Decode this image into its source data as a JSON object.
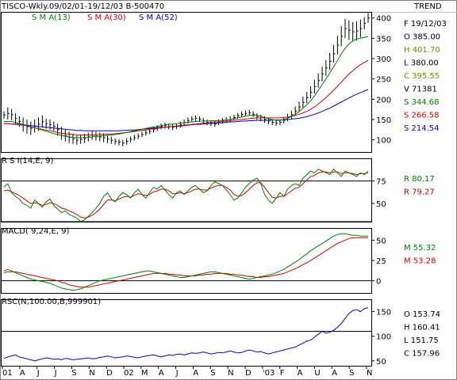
{
  "header": {
    "title": "TISCO-Wkly.09/02/01-19/12/03  B-500470",
    "right": "TREND"
  },
  "chart_data": [
    {
      "type": "line",
      "panel": "price",
      "legend": [
        {
          "name": "S M A(13)",
          "color": "#008000"
        },
        {
          "name": "S M A(30)",
          "color": "#d00000"
        },
        {
          "name": "S M A(52)",
          "color": "#0000c0"
        }
      ],
      "ylim": [
        70,
        415
      ],
      "yticks": [
        "400",
        "350",
        "300",
        "250",
        "200",
        "150",
        "100"
      ],
      "price_hl": [
        [
          170,
          152
        ],
        [
          180,
          150
        ],
        [
          176,
          148
        ],
        [
          165,
          140
        ],
        [
          158,
          132
        ],
        [
          155,
          120
        ],
        [
          150,
          115
        ],
        [
          145,
          112
        ],
        [
          150,
          118
        ],
        [
          155,
          122
        ],
        [
          160,
          130
        ],
        [
          152,
          128
        ],
        [
          150,
          125
        ],
        [
          145,
          122
        ],
        [
          140,
          110
        ],
        [
          132,
          100
        ],
        [
          125,
          96
        ],
        [
          120,
          92
        ],
        [
          115,
          90
        ],
        [
          110,
          88
        ],
        [
          112,
          90
        ],
        [
          115,
          92
        ],
        [
          118,
          96
        ],
        [
          122,
          100
        ],
        [
          120,
          98
        ],
        [
          118,
          96
        ],
        [
          116,
          94
        ],
        [
          112,
          92
        ],
        [
          108,
          90
        ],
        [
          104,
          88
        ],
        [
          102,
          86
        ],
        [
          100,
          84
        ],
        [
          104,
          88
        ],
        [
          108,
          94
        ],
        [
          112,
          98
        ],
        [
          116,
          102
        ],
        [
          120,
          106
        ],
        [
          124,
          110
        ],
        [
          128,
          114
        ],
        [
          132,
          118
        ],
        [
          136,
          122
        ],
        [
          140,
          126
        ],
        [
          142,
          128
        ],
        [
          140,
          126
        ],
        [
          138,
          124
        ],
        [
          140,
          126
        ],
        [
          145,
          130
        ],
        [
          150,
          135
        ],
        [
          155,
          140
        ],
        [
          158,
          144
        ],
        [
          160,
          146
        ],
        [
          158,
          144
        ],
        [
          154,
          140
        ],
        [
          150,
          136
        ],
        [
          148,
          134
        ],
        [
          146,
          132
        ],
        [
          150,
          136
        ],
        [
          154,
          140
        ],
        [
          156,
          142
        ],
        [
          158,
          144
        ],
        [
          162,
          148
        ],
        [
          166,
          152
        ],
        [
          170,
          155
        ],
        [
          172,
          158
        ],
        [
          174,
          160
        ],
        [
          170,
          156
        ],
        [
          166,
          150
        ],
        [
          162,
          146
        ],
        [
          158,
          142
        ],
        [
          154,
          138
        ],
        [
          150,
          136
        ],
        [
          148,
          134
        ],
        [
          150,
          136
        ],
        [
          156,
          140
        ],
        [
          164,
          146
        ],
        [
          172,
          152
        ],
        [
          182,
          160
        ],
        [
          194,
          168
        ],
        [
          206,
          178
        ],
        [
          218,
          190
        ],
        [
          232,
          202
        ],
        [
          248,
          214
        ],
        [
          264,
          228
        ],
        [
          280,
          244
        ],
        [
          296,
          258
        ],
        [
          314,
          272
        ],
        [
          334,
          290
        ],
        [
          356,
          310
        ],
        [
          380,
          330
        ],
        [
          398,
          350
        ],
        [
          394,
          346
        ],
        [
          390,
          342
        ],
        [
          392,
          344
        ],
        [
          396,
          352
        ],
        [
          402,
          372
        ],
        [
          412,
          388
        ]
      ],
      "sma13": [
        145,
        145,
        145,
        143,
        140,
        138,
        135,
        132,
        130,
        127,
        124,
        121,
        118,
        115,
        113,
        111,
        109,
        107,
        106,
        105,
        105,
        105,
        106,
        107,
        108,
        109,
        110,
        111,
        112,
        113,
        114,
        116,
        118,
        120,
        122,
        124,
        126,
        128,
        130,
        132,
        133,
        135,
        137,
        138,
        139,
        140,
        141,
        142,
        143,
        144,
        145,
        146,
        146,
        146,
        147,
        147,
        147,
        148,
        149,
        150,
        152,
        154,
        156,
        158,
        160,
        161,
        160,
        158,
        155,
        152,
        150,
        148,
        148,
        150,
        153,
        158,
        163,
        170,
        178,
        186,
        196,
        208,
        222,
        236,
        250,
        265,
        280,
        295,
        312,
        325,
        336,
        344,
        348,
        350,
        352,
        354
      ],
      "sma30": [
        140,
        140,
        139,
        138,
        137,
        136,
        134,
        132,
        130,
        128,
        126,
        124,
        122,
        120,
        118,
        116,
        115,
        114,
        113,
        112,
        112,
        112,
        112,
        112,
        112,
        113,
        113,
        114,
        114,
        115,
        116,
        117,
        118,
        119,
        120,
        122,
        123,
        124,
        126,
        127,
        128,
        130,
        131,
        132,
        133,
        134,
        135,
        136,
        137,
        138,
        139,
        140,
        141,
        142,
        143,
        144,
        144,
        145,
        146,
        147,
        148,
        149,
        150,
        151,
        152,
        153,
        154,
        154,
        154,
        154,
        154,
        154,
        154,
        155,
        156,
        158,
        160,
        163,
        166,
        170,
        175,
        181,
        188,
        196,
        204,
        213,
        222,
        232,
        242,
        252,
        262,
        270,
        278,
        285,
        290,
        296
      ],
      "sma52": [
        140,
        140,
        139,
        139,
        138,
        137,
        136,
        135,
        134,
        133,
        132,
        131,
        130,
        129,
        128,
        127,
        126,
        125,
        124,
        123,
        123,
        122,
        122,
        122,
        122,
        122,
        122,
        122,
        122,
        122,
        122,
        123,
        123,
        124,
        124,
        125,
        126,
        127,
        128,
        129,
        130,
        131,
        131,
        132,
        133,
        133,
        134,
        135,
        136,
        137,
        138,
        138,
        139,
        140,
        140,
        141,
        142,
        142,
        143,
        144,
        144,
        145,
        146,
        146,
        147,
        147,
        148,
        148,
        148,
        148,
        149,
        149,
        149,
        150,
        150,
        151,
        152,
        153,
        155,
        157,
        160,
        163,
        166,
        170,
        174,
        178,
        183,
        188,
        193,
        198,
        203,
        208,
        212,
        216,
        220,
        224
      ],
      "readouts": [
        {
          "label": "F 19/12/03",
          "color": "#000000"
        },
        {
          "label": "O   385.00",
          "color": "#000000"
        },
        {
          "label": "H   401.70",
          "color": "#808000"
        },
        {
          "label": "L   380.00",
          "color": "#000000"
        },
        {
          "label": "C   395.55",
          "color": "#808000"
        },
        {
          "label": "V    71381",
          "color": "#000000"
        },
        {
          "label": "S   344.68",
          "color": "#008000"
        },
        {
          "label": "S   266.58",
          "color": "#d00000"
        },
        {
          "label": "S   214.54",
          "color": "#0000c0"
        }
      ]
    },
    {
      "type": "line",
      "panel": "rsi",
      "title": "R S I(14,E, 9)",
      "ylim": [
        30,
        100
      ],
      "yticks": [
        "75",
        "50"
      ],
      "ref_lines": [
        75,
        30
      ],
      "rsi": [
        68,
        72,
        62,
        58,
        55,
        50,
        48,
        45,
        54,
        50,
        46,
        52,
        55,
        48,
        44,
        40,
        42,
        38,
        36,
        34,
        30,
        32,
        36,
        40,
        45,
        50,
        58,
        62,
        55,
        52,
        58,
        62,
        60,
        56,
        62,
        66,
        60,
        56,
        62,
        68,
        66,
        70,
        65,
        60,
        56,
        62,
        64,
        60,
        64,
        68,
        70,
        66,
        62,
        64,
        70,
        74,
        72,
        70,
        65,
        60,
        54,
        56,
        62,
        68,
        72,
        76,
        78,
        72,
        60,
        54,
        50,
        56,
        62,
        58,
        66,
        70,
        72,
        70,
        78,
        82,
        86,
        84,
        88,
        86,
        84,
        82,
        88,
        84,
        80,
        86,
        84,
        82,
        80,
        84,
        82,
        86
      ],
      "signal": [
        64,
        65,
        63,
        61,
        59,
        56,
        53,
        50,
        51,
        50,
        48,
        49,
        51,
        50,
        48,
        45,
        44,
        42,
        40,
        38,
        35,
        34,
        35,
        37,
        40,
        44,
        49,
        54,
        54,
        53,
        55,
        57,
        58,
        57,
        59,
        61,
        60,
        59,
        60,
        63,
        64,
        66,
        66,
        64,
        61,
        61,
        62,
        61,
        62,
        64,
        66,
        66,
        65,
        65,
        67,
        69,
        70,
        70,
        68,
        65,
        60,
        58,
        59,
        62,
        66,
        70,
        73,
        73,
        68,
        62,
        57,
        56,
        58,
        58,
        61,
        64,
        67,
        68,
        72,
        76,
        80,
        81,
        84,
        85,
        85,
        84,
        85,
        85,
        83,
        84,
        84,
        83,
        82,
        83,
        83,
        84
      ],
      "readouts": [
        {
          "label": "R    80.17",
          "color": "#008000"
        },
        {
          "label": "R    79.27",
          "color": "#d00000"
        }
      ]
    },
    {
      "type": "line",
      "panel": "macd",
      "title": "MACD( 9,24,E, 9)",
      "ylim": [
        -15,
        65
      ],
      "yticks": [
        "50",
        "25",
        "0"
      ],
      "ref_lines": [
        0
      ],
      "macd": [
        12,
        14,
        12,
        10,
        8,
        6,
        4,
        2,
        1,
        0,
        -1,
        -2,
        -3,
        -5,
        -7,
        -9,
        -10,
        -11,
        -12,
        -11,
        -10,
        -8,
        -6,
        -4,
        -2,
        0,
        1,
        2,
        3,
        4,
        5,
        6,
        7,
        8,
        9,
        10,
        11,
        12,
        12,
        11,
        10,
        9,
        8,
        7,
        6,
        5,
        4,
        4,
        5,
        6,
        7,
        8,
        9,
        10,
        11,
        11,
        10,
        9,
        8,
        7,
        6,
        5,
        4,
        3,
        2,
        3,
        4,
        5,
        6,
        7,
        8,
        10,
        12,
        14,
        17,
        20,
        23,
        26,
        30,
        33,
        37,
        40,
        43,
        46,
        49,
        52,
        55,
        57,
        58,
        58,
        57,
        56,
        56,
        55,
        55,
        55
      ],
      "signal": [
        10,
        11,
        11,
        11,
        10,
        9,
        8,
        7,
        6,
        5,
        4,
        3,
        2,
        1,
        0,
        -2,
        -3,
        -5,
        -6,
        -7,
        -8,
        -8,
        -8,
        -7,
        -6,
        -5,
        -4,
        -3,
        -2,
        -1,
        0,
        1,
        2,
        3,
        4,
        5,
        6,
        7,
        8,
        9,
        9,
        9,
        9,
        8,
        8,
        7,
        7,
        6,
        6,
        6,
        6,
        7,
        7,
        8,
        8,
        9,
        9,
        9,
        9,
        8,
        8,
        7,
        7,
        6,
        5,
        5,
        4,
        4,
        5,
        5,
        6,
        7,
        8,
        9,
        11,
        13,
        15,
        17,
        20,
        22,
        25,
        28,
        31,
        34,
        37,
        40,
        43,
        46,
        48,
        50,
        52,
        53,
        53,
        53,
        53,
        53
      ],
      "readouts": [
        {
          "label": "M    55.32",
          "color": "#008000"
        },
        {
          "label": "M    53.28",
          "color": "#d00000"
        }
      ]
    },
    {
      "type": "line",
      "panel": "rsc",
      "title": "RSC(N,100.00,B,999901)",
      "ylim": [
        40,
        175
      ],
      "yticks": [
        "150",
        "100",
        "50"
      ],
      "ref_lines": [
        110
      ],
      "rsc": [
        55,
        58,
        60,
        62,
        58,
        56,
        54,
        52,
        50,
        52,
        54,
        56,
        55,
        53,
        54,
        52,
        55,
        54,
        52,
        53,
        54,
        55,
        56,
        54,
        55,
        57,
        58,
        60,
        58,
        56,
        57,
        58,
        60,
        59,
        57,
        56,
        58,
        60,
        61,
        62,
        60,
        58,
        60,
        62,
        61,
        63,
        64,
        62,
        64,
        66,
        65,
        66,
        68,
        66,
        64,
        65,
        67,
        66,
        68,
        70,
        68,
        66,
        67,
        70,
        72,
        70,
        68,
        69,
        66,
        64,
        66,
        68,
        70,
        72,
        74,
        76,
        78,
        82,
        86,
        90,
        92,
        98,
        104,
        110,
        106,
        108,
        112,
        118,
        126,
        136,
        146,
        152,
        154,
        150,
        156,
        158
      ],
      "readouts": [
        {
          "label": "O   153.74",
          "color": "#000000"
        },
        {
          "label": "H   160.41",
          "color": "#000000"
        },
        {
          "label": "L   151.75",
          "color": "#000000"
        },
        {
          "label": "C   157.96",
          "color": "#000000"
        }
      ]
    }
  ],
  "x_axis": {
    "labels": [
      "01",
      "A",
      "J",
      "J",
      "S",
      "N",
      "D",
      "02",
      "M",
      "A",
      "J",
      "A",
      "S",
      "N",
      "D",
      "'03",
      "F",
      "A",
      "U",
      "A",
      "S",
      "N"
    ]
  }
}
